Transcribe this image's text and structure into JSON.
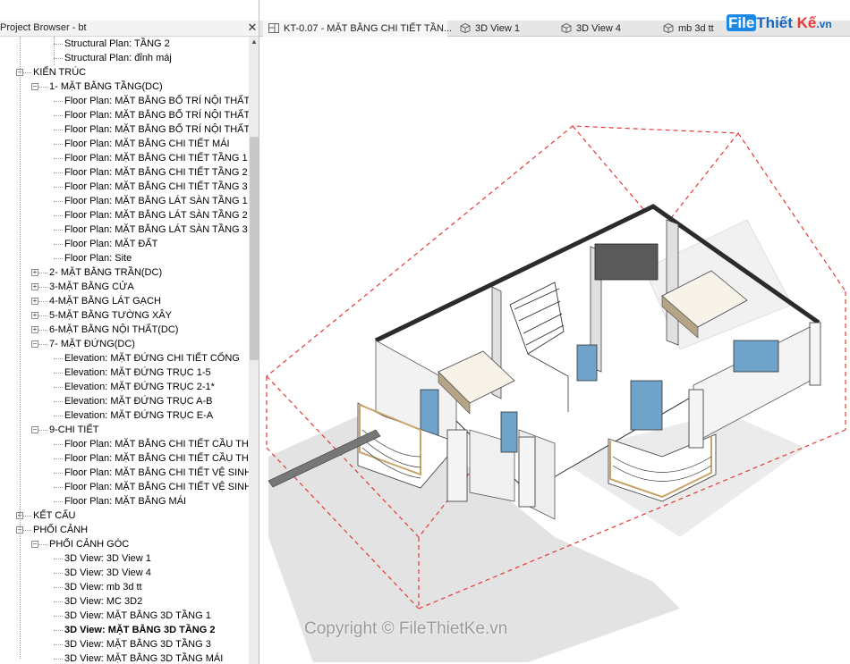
{
  "browser": {
    "title": "Project Browser - bt",
    "close_glyph": "✕"
  },
  "tree": [
    {
      "label": "Structural Plan: TẦNG 2",
      "level": 3,
      "leaf": true
    },
    {
      "label": "Structural Plan: đỉnh máj",
      "level": 3,
      "leaf": true
    },
    {
      "label": "KIẾN TRÚC",
      "level": 1,
      "toggle": "-"
    },
    {
      "label": "1- MẶT BẰNG TẦNG(DC)",
      "level": 2,
      "toggle": "-"
    },
    {
      "label": "Floor Plan: MẶT BẰNG BỐ TRÍ NỘI THẤT TẦ",
      "level": 3,
      "leaf": true
    },
    {
      "label": "Floor Plan: MẶT BẰNG BỐ TRÍ NỘI THẤT TẦ",
      "level": 3,
      "leaf": true
    },
    {
      "label": "Floor Plan: MẶT BẰNG BỐ TRÍ NỘI THẤT TẦ",
      "level": 3,
      "leaf": true
    },
    {
      "label": "Floor Plan: MẶT BẰNG CHI TIẾT MÁI",
      "level": 3,
      "leaf": true
    },
    {
      "label": "Floor Plan: MẶT BẰNG CHI TIẾT TẦNG 1",
      "level": 3,
      "leaf": true
    },
    {
      "label": "Floor Plan: MẶT BẰNG CHI TIẾT TẦNG 2",
      "level": 3,
      "leaf": true
    },
    {
      "label": "Floor Plan: MẶT BẰNG CHI TIẾT TẦNG 3",
      "level": 3,
      "leaf": true
    },
    {
      "label": "Floor Plan: MẶT BẰNG LÁT SÀN TẦNG 1",
      "level": 3,
      "leaf": true
    },
    {
      "label": "Floor Plan: MẶT BẰNG LÁT SÀN TẦNG 2",
      "level": 3,
      "leaf": true
    },
    {
      "label": "Floor Plan: MẶT BẰNG LÁT SÀN TẦNG 3",
      "level": 3,
      "leaf": true
    },
    {
      "label": "Floor Plan: MẶT ĐẤT",
      "level": 3,
      "leaf": true
    },
    {
      "label": "Floor Plan: Site",
      "level": 3,
      "leaf": true
    },
    {
      "label": "2- MẶT BẰNG TRẦN(DC)",
      "level": 2,
      "toggle": "+"
    },
    {
      "label": "3-MẶT BẰNG CỬA",
      "level": 2,
      "toggle": "+"
    },
    {
      "label": "4-MẶT BẰNG LÁT GẠCH",
      "level": 2,
      "toggle": "+"
    },
    {
      "label": "5-MẶT BẰNG TƯỜNG XÂY",
      "level": 2,
      "toggle": "+"
    },
    {
      "label": "6-MẶT BẰNG NỘI THẤT(DC)",
      "level": 2,
      "toggle": "+"
    },
    {
      "label": "7- MẶT ĐỨNG(DC)",
      "level": 2,
      "toggle": "-"
    },
    {
      "label": "Elevation: MẶT ĐỨNG CHI TIẾT CỔNG",
      "level": 3,
      "leaf": true
    },
    {
      "label": "Elevation: MẶT ĐỨNG TRỤC 1-5",
      "level": 3,
      "leaf": true
    },
    {
      "label": "Elevation: MẶT ĐỨNG TRỤC 2-1*",
      "level": 3,
      "leaf": true
    },
    {
      "label": "Elevation: MẶT ĐỨNG TRỤC A-B",
      "level": 3,
      "leaf": true
    },
    {
      "label": "Elevation: MẶT ĐỨNG TRỤC E-A",
      "level": 3,
      "leaf": true
    },
    {
      "label": "9-CHI TIẾT",
      "level": 2,
      "toggle": "-"
    },
    {
      "label": "Floor Plan: MẶT BẰNG CHI TIẾT CẦU THANG",
      "level": 3,
      "leaf": true
    },
    {
      "label": "Floor Plan: MẶT BẰNG CHI TIẾT CẦU THANG",
      "level": 3,
      "leaf": true
    },
    {
      "label": "Floor Plan: MẶT BẰNG CHI TIẾT VỆ SINH WC",
      "level": 3,
      "leaf": true
    },
    {
      "label": "Floor Plan: MẶT BẰNG CHI TIẾT VỆ SINH WC",
      "level": 3,
      "leaf": true
    },
    {
      "label": "Floor Plan: MẶT BẰNG MÁI",
      "level": 3,
      "leaf": true
    },
    {
      "label": "KẾT CẤU",
      "level": 1,
      "toggle": "+"
    },
    {
      "label": "PHỐI CẢNH",
      "level": 1,
      "toggle": "-"
    },
    {
      "label": "PHỐI CẢNH GÓC",
      "level": 2,
      "toggle": "-"
    },
    {
      "label": "3D View: 3D View 1",
      "level": 3,
      "leaf": true
    },
    {
      "label": "3D View: 3D View 4",
      "level": 3,
      "leaf": true
    },
    {
      "label": "3D View: mb 3d tt",
      "level": 3,
      "leaf": true
    },
    {
      "label": "3D View: MC 3D2",
      "level": 3,
      "leaf": true
    },
    {
      "label": "3D View: MẶT BẰNG 3D TẦNG 1",
      "level": 3,
      "leaf": true
    },
    {
      "label": "3D View: MẶT BẰNG 3D TẦNG 2",
      "level": 3,
      "leaf": true,
      "selected": true
    },
    {
      "label": "3D View: MẶT BẰNG 3D TẦNG 3",
      "level": 3,
      "leaf": true
    },
    {
      "label": "3D View: MẶT BẰNG 3D TẦNG MÁI",
      "level": 3,
      "leaf": true
    }
  ],
  "tabs": [
    {
      "label": "KT-0.07 - MẶT BẰNG CHI TIẾT TẦN...",
      "icon": "floor-plan-icon",
      "active": true
    },
    {
      "label": "3D View 1",
      "icon": "3d-cube-icon"
    },
    {
      "label": "3D View 4",
      "icon": "3d-cube-icon"
    },
    {
      "label": "mb 3d tt",
      "icon": "3d-cube-icon"
    }
  ],
  "watermark": {
    "logo_file": "File",
    "logo_thiet": "Thiết ",
    "logo_ke": "Kế",
    "logo_dom": ".vn",
    "copyright": "Copyright © FileThietKe.vn"
  },
  "colors": {
    "section_box": "#e53935",
    "walls": "#f2f2f2",
    "wall_tops": "#2b2b2b",
    "glass": "#6fa3c9",
    "floor": "#ffffff",
    "railing": "#c8a46a",
    "shadow": "#dcdcdc"
  }
}
